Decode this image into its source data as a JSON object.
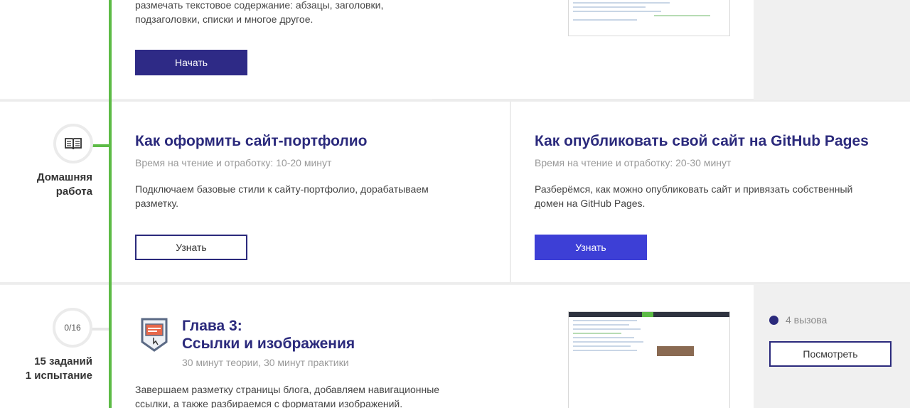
{
  "top_lesson": {
    "description_line1": "размечать текстовое содержание: абзацы, заголовки,",
    "description_line2": "подзаголовки, списки и многое другое.",
    "button_label": "Начать"
  },
  "homework": {
    "label_line1": "Домашняя",
    "label_line2": "работа",
    "icon": "open-book-icon",
    "cards": [
      {
        "title": "Как оформить сайт-портфолио",
        "meta": "Время на чтение и отработку: 10-20 минут",
        "description_line1": "Подключаем базовые стили к сайту-портфолио, дорабатываем",
        "description_line2": "разметку.",
        "button_label": "Узнать"
      },
      {
        "title": "Как опубликовать свой сайт на GitHub Pages",
        "meta": "Время на чтение и отработку: 20-30 минут",
        "description_line1": "Разберёмся, как можно опубликовать сайт и привязать собственный",
        "description_line2": "домен на GitHub Pages.",
        "button_label": "Узнать"
      }
    ]
  },
  "chapter3": {
    "progress": "0/16",
    "label_line1": "15 заданий",
    "label_line2": "1 испытание",
    "title_line1": "Глава 3:",
    "title_line2": "Ссылки и изображения",
    "meta": "30 минут теории, 30 минут практики",
    "description_line1": "Завершаем разметку страницы блога, добавляем навигационные",
    "description_line2": "ссылки, а также разбираемся с форматами изображений.",
    "challenges": "4 вызова",
    "button_label": "Посмотреть",
    "icon": "chapter-badge-icon"
  },
  "colors": {
    "accent": "#2b2a7c",
    "timeline": "#5dbb46",
    "primary_button": "#3d3fd6"
  }
}
